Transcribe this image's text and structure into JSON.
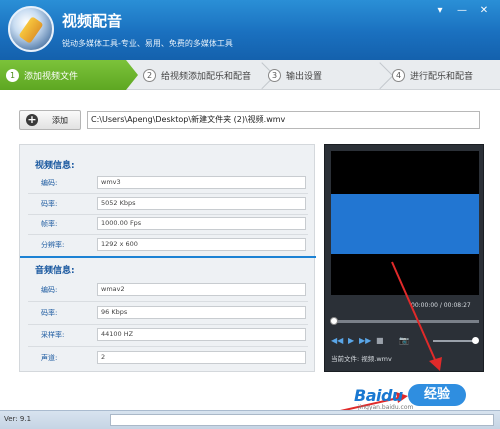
{
  "app": {
    "title": "视频配音",
    "subtitle": "锐动多媒体工具-专业、易用、免费的多媒体工具",
    "window_buttons": [
      "▾",
      "—",
      "✕"
    ]
  },
  "steps": [
    {
      "number": "1",
      "label": "添加视频文件",
      "active": true
    },
    {
      "number": "2",
      "label": "给视频添加配乐和配音",
      "active": false
    },
    {
      "number": "3",
      "label": "输出设置",
      "active": false
    },
    {
      "number": "4",
      "label": "进行配乐和配音",
      "active": false
    }
  ],
  "add_button": {
    "label": "添加",
    "icon": "plus-icon"
  },
  "file_path": "C:\\Users\\Apeng\\Desktop\\新建文件夹 (2)\\视频.wmv",
  "video_info": {
    "title": "视频信息:",
    "rows": [
      {
        "label": "编码:",
        "value": "wmv3"
      },
      {
        "label": "码率:",
        "value": "5052 Kbps"
      },
      {
        "label": "帧率:",
        "value": "1000.00 Fps"
      },
      {
        "label": "分辨率:",
        "value": "1292 x 600"
      }
    ]
  },
  "audio_info": {
    "title": "音频信息:",
    "rows": [
      {
        "label": "编码:",
        "value": "wmav2"
      },
      {
        "label": "码率:",
        "value": "96 Kbps"
      },
      {
        "label": "采样率:",
        "value": "44100 HZ"
      },
      {
        "label": "声道:",
        "value": "2"
      }
    ]
  },
  "player": {
    "time": "00:00:00 / 00:08:27",
    "controls": [
      "◀◀",
      "▶",
      "▶▶",
      "■",
      "📷"
    ],
    "current_file_label": "当前文件: 视频.wmv"
  },
  "watermark": {
    "text": "Baidu",
    "badge": "经验",
    "domain": "jingyan.baidu.com"
  },
  "status": {
    "version": "Ver: 9.1"
  },
  "colors": {
    "header": "#1a70bf",
    "active_step": "#5ea722",
    "accent_blue": "#1c5aa0",
    "annotation_red": "#e02a2a"
  }
}
